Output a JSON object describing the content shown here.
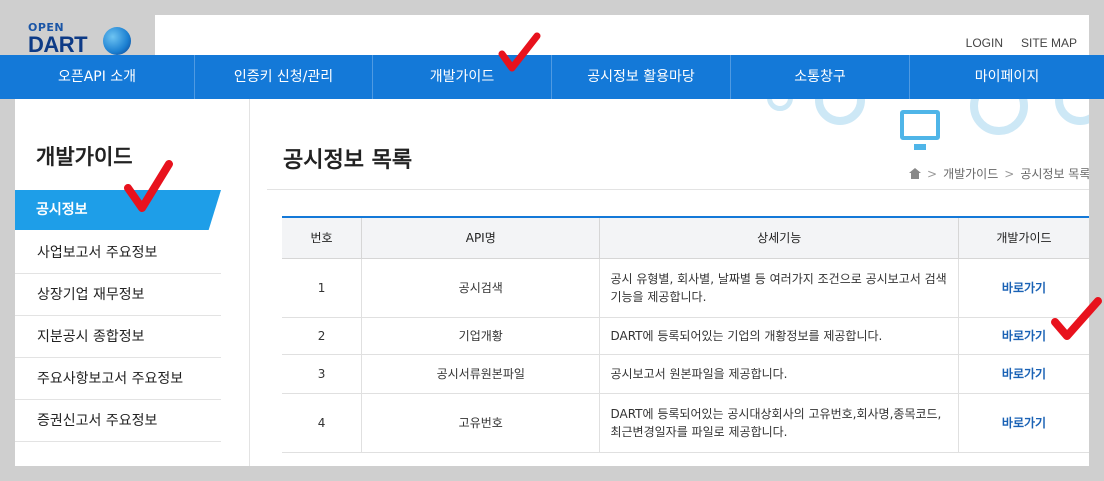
{
  "logo": {
    "open": "OPEN",
    "dart": "DART"
  },
  "top_links": [
    "LOGIN",
    "SITE MAP"
  ],
  "gnb": [
    "오픈API 소개",
    "인증키 신청/관리",
    "개발가이드",
    "공시정보 활용마당",
    "소통창구",
    "마이페이지"
  ],
  "sidebar": {
    "title": "개발가이드",
    "active": "공시정보",
    "items": [
      "사업보고서 주요정보",
      "상장기업 재무정보",
      "지분공시 종합정보",
      "주요사항보고서 주요정보",
      "증권신고서 주요정보"
    ]
  },
  "content": {
    "title": "공시정보 목록",
    "breadcrumb": [
      "개발가이드",
      "공시정보 목록"
    ]
  },
  "table": {
    "headers": [
      "번호",
      "API명",
      "상세기능",
      "개발가이드"
    ],
    "rows": [
      {
        "no": "1",
        "name": "공시검색",
        "desc": "공시 유형별, 회사별, 날짜별 등 여러가지 조건으로 공시보고서 검색기능을 제공합니다.",
        "link": "바로가기"
      },
      {
        "no": "2",
        "name": "기업개황",
        "desc": "DART에 등록되어있는 기업의 개황정보를 제공합니다.",
        "link": "바로가기"
      },
      {
        "no": "3",
        "name": "공시서류원본파일",
        "desc": "공시보고서 원본파일을 제공합니다.",
        "link": "바로가기"
      },
      {
        "no": "4",
        "name": "고유번호",
        "desc": "DART에 등록되어있는 공시대상회사의 고유번호,회사명,종목코드, 최근변경일자를 파일로 제공합니다.",
        "link": "바로가기"
      }
    ]
  },
  "colors": {
    "nav": "#1479d8",
    "active": "#1e9ee8",
    "check": "#e8121d",
    "link": "#1a62b5"
  }
}
